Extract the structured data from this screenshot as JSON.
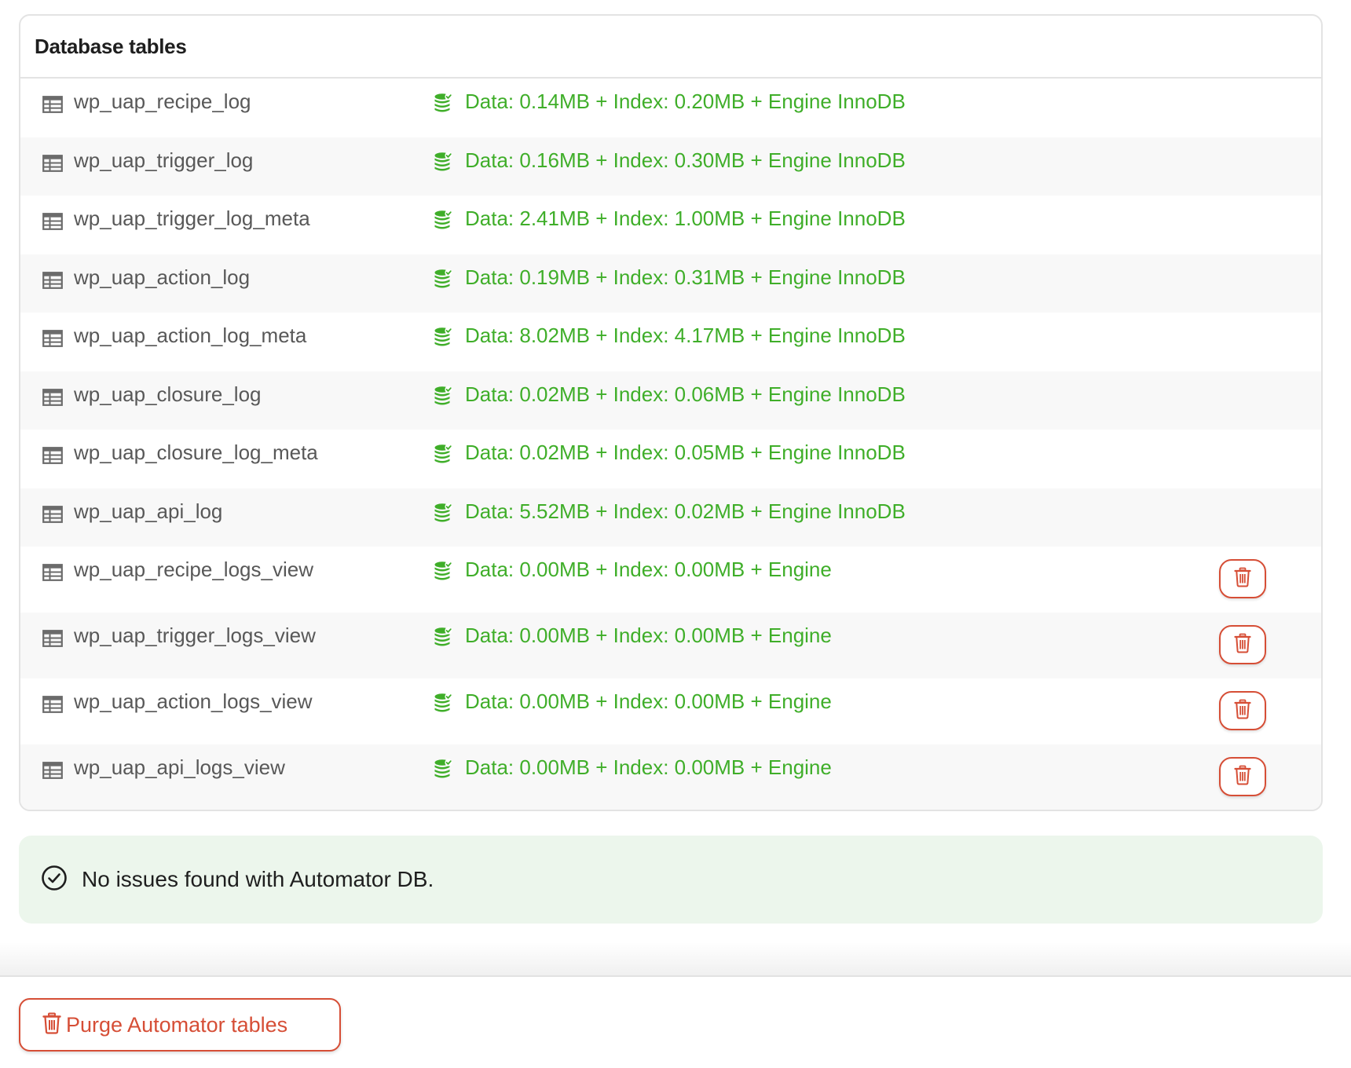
{
  "panel": {
    "title": "Database tables"
  },
  "rows": [
    {
      "name": "wp_uap_recipe_log",
      "info": "Data: 0.14MB + Index: 0.20MB + Engine InnoDB",
      "deletable": false
    },
    {
      "name": "wp_uap_trigger_log",
      "info": "Data: 0.16MB + Index: 0.30MB + Engine InnoDB",
      "deletable": false
    },
    {
      "name": "wp_uap_trigger_log_meta",
      "info": "Data: 2.41MB + Index: 1.00MB + Engine InnoDB",
      "deletable": false
    },
    {
      "name": "wp_uap_action_log",
      "info": "Data: 0.19MB + Index: 0.31MB + Engine InnoDB",
      "deletable": false
    },
    {
      "name": "wp_uap_action_log_meta",
      "info": "Data: 8.02MB + Index: 4.17MB + Engine InnoDB",
      "deletable": false
    },
    {
      "name": "wp_uap_closure_log",
      "info": "Data: 0.02MB + Index: 0.06MB + Engine InnoDB",
      "deletable": false
    },
    {
      "name": "wp_uap_closure_log_meta",
      "info": "Data: 0.02MB + Index: 0.05MB + Engine InnoDB",
      "deletable": false
    },
    {
      "name": "wp_uap_api_log",
      "info": "Data: 5.52MB + Index: 0.02MB + Engine InnoDB",
      "deletable": false
    },
    {
      "name": "wp_uap_recipe_logs_view",
      "info": "Data: 0.00MB + Index: 0.00MB + Engine",
      "deletable": true
    },
    {
      "name": "wp_uap_trigger_logs_view",
      "info": "Data: 0.00MB + Index: 0.00MB + Engine",
      "deletable": true
    },
    {
      "name": "wp_uap_action_logs_view",
      "info": "Data: 0.00MB + Index: 0.00MB + Engine",
      "deletable": true
    },
    {
      "name": "wp_uap_api_logs_view",
      "info": "Data: 0.00MB + Index: 0.00MB + Engine",
      "deletable": true
    }
  ],
  "icons": {
    "table": "table-icon",
    "database": "database-icon",
    "delete": "trash-icon",
    "notice": "check-circle-icon"
  },
  "notice": {
    "message": "No issues found with Automator DB."
  },
  "purge_button": {
    "label": "Purge Automator tables"
  },
  "colors": {
    "success_text": "#3fae29",
    "danger": "#d64e36",
    "notice_bg": "#ecf6ec"
  }
}
